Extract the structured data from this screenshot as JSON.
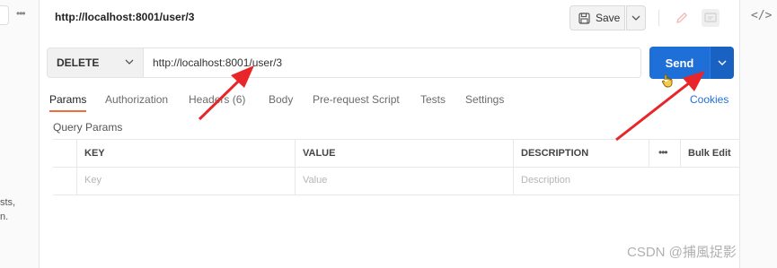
{
  "header": {
    "title": "http://localhost:8001/user/3",
    "save_label": "Save"
  },
  "request": {
    "method": "DELETE",
    "url": "http://localhost:8001/user/3",
    "send_label": "Send"
  },
  "tabs": [
    {
      "label": "Params",
      "active": true
    },
    {
      "label": "Authorization",
      "active": false
    },
    {
      "label": "Headers",
      "count": "(6)",
      "active": false
    },
    {
      "label": "Body",
      "active": false
    },
    {
      "label": "Pre-request Script",
      "active": false
    },
    {
      "label": "Tests",
      "active": false
    },
    {
      "label": "Settings",
      "active": false
    }
  ],
  "cookies_label": "Cookies",
  "query_params": {
    "section_title": "Query Params",
    "columns": [
      "KEY",
      "VALUE",
      "DESCRIPTION"
    ],
    "placeholders": [
      "Key",
      "Value",
      "Description"
    ],
    "bulk_edit_label": "Bulk Edit"
  },
  "left_fragments": [
    "sts,",
    "n."
  ],
  "watermark": "CSDN @捕風捉影",
  "colors": {
    "accent_orange": "#f26b3a",
    "send_blue": "#1f6fd8",
    "annotation_red": "#e8262a"
  },
  "icons": [
    "save-icon",
    "chevron-down-icon",
    "edit-icon",
    "comment-icon",
    "code-icon",
    "more-icon",
    "hand-cursor-icon"
  ]
}
